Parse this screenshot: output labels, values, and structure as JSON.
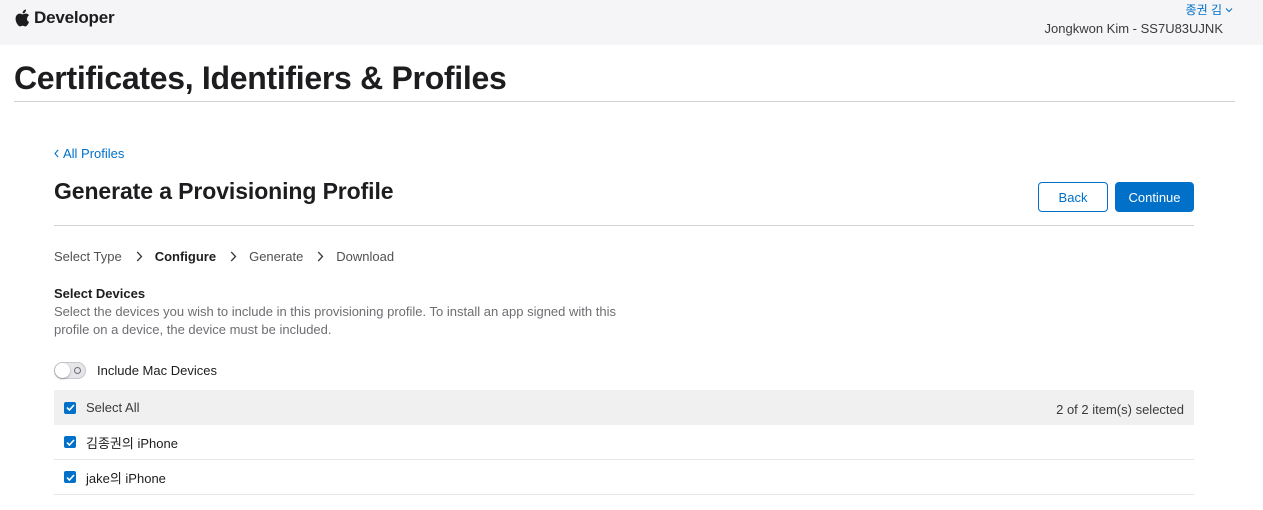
{
  "nav": {
    "brand": "Developer",
    "user_name": "종권 김",
    "team": "Jongkwon Kim - SS7U83UJNK"
  },
  "page": {
    "title": "Certificates, Identifiers & Profiles"
  },
  "content": {
    "back_link": "All Profiles",
    "section_title": "Generate a Provisioning Profile",
    "buttons": {
      "back": "Back",
      "continue": "Continue"
    },
    "steps": [
      {
        "label": "Select Type",
        "active": false
      },
      {
        "label": "Configure",
        "active": true
      },
      {
        "label": "Generate",
        "active": false
      },
      {
        "label": "Download",
        "active": false
      }
    ],
    "devices": {
      "heading": "Select Devices",
      "description": "Select the devices you wish to include in this provisioning profile. To install an app signed with this profile on a device, the device must be included.",
      "mac_toggle_label": "Include Mac Devices",
      "mac_toggle_on": false,
      "select_all_label": "Select All",
      "select_all_checked": true,
      "selected_count": "2 of 2 item(s) selected",
      "items": [
        {
          "name": "김종권의 iPhone",
          "checked": true
        },
        {
          "name": "jake의 iPhone",
          "checked": true
        }
      ]
    }
  },
  "colors": {
    "accent": "#0070c9",
    "nav_bg": "#f5f5f7",
    "header_row_bg": "#f0f0f0"
  },
  "icons": {
    "brand": "apple-logo-icon",
    "user_menu": "chevron-down-icon",
    "back": "chevron-left-icon",
    "step_separator": "chevron-right-icon",
    "checkbox": "checkmark-icon"
  }
}
